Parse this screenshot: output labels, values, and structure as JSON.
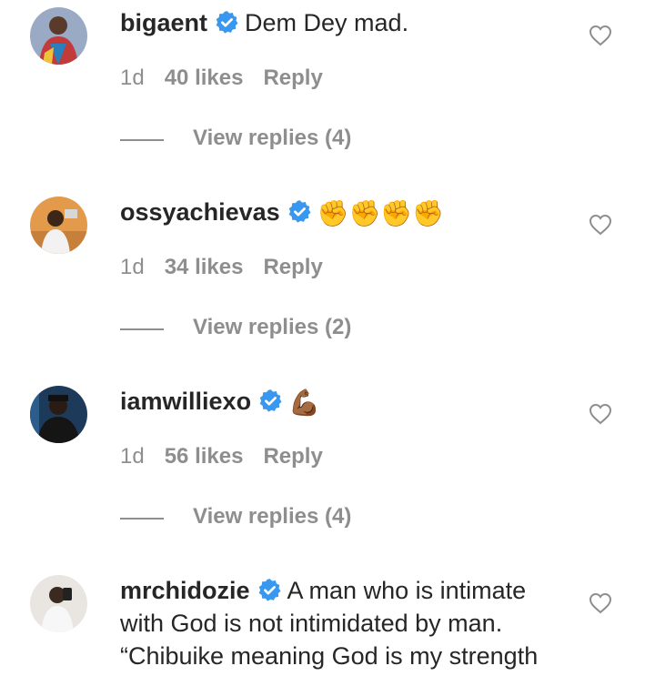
{
  "comments": [
    {
      "username": "bigaent",
      "text": "Dem Dey mad.",
      "emoji": "",
      "time": "1d",
      "likes": "40 likes",
      "reply_label": "Reply",
      "view_replies": "View replies (4)"
    },
    {
      "username": "ossyachievas",
      "text": "",
      "emoji": "✊✊✊✊",
      "time": "1d",
      "likes": "34 likes",
      "reply_label": "Reply",
      "view_replies": "View replies (2)"
    },
    {
      "username": "iamwilliexo",
      "text": "",
      "emoji": "💪🏾",
      "time": "1d",
      "likes": "56 likes",
      "reply_label": "Reply",
      "view_replies": "View replies (4)"
    },
    {
      "username": "mrchidozie",
      "text": "A man who is intimate with God is not intimidated by man. “Chibuike meaning God is my strength",
      "emoji": "",
      "time": "",
      "likes": "",
      "reply_label": "",
      "view_replies": ""
    }
  ],
  "icons": {
    "verified": "verified-badge-icon",
    "like": "heart-outline-icon"
  },
  "colors": {
    "verified_blue": "#3897f0",
    "muted_text": "#8e8e8e",
    "primary_text": "#262626"
  }
}
